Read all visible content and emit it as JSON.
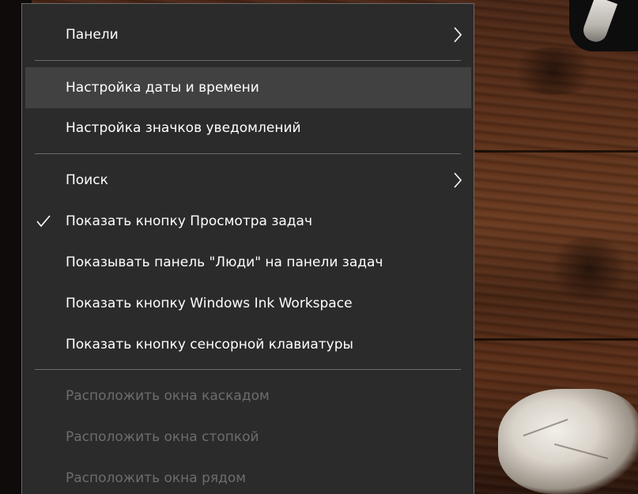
{
  "menu": {
    "items": [
      {
        "label": "Панели",
        "has_submenu": true,
        "checked": false,
        "disabled": false
      },
      {
        "label": "Настройка даты и времени",
        "has_submenu": false,
        "checked": false,
        "disabled": false,
        "hovered": true
      },
      {
        "label": "Настройка значков уведомлений",
        "has_submenu": false,
        "checked": false,
        "disabled": false
      },
      {
        "label": "Поиск",
        "has_submenu": true,
        "checked": false,
        "disabled": false
      },
      {
        "label": "Показать кнопку Просмотра задач",
        "has_submenu": false,
        "checked": true,
        "disabled": false
      },
      {
        "label": "Показывать панель \"Люди\" на панели задач",
        "has_submenu": false,
        "checked": false,
        "disabled": false
      },
      {
        "label": "Показать кнопку Windows Ink Workspace",
        "has_submenu": false,
        "checked": false,
        "disabled": false
      },
      {
        "label": "Показать кнопку сенсорной клавиатуры",
        "has_submenu": false,
        "checked": false,
        "disabled": false
      },
      {
        "label": "Расположить окна каскадом",
        "has_submenu": false,
        "checked": false,
        "disabled": true
      },
      {
        "label": "Расположить окна стопкой",
        "has_submenu": false,
        "checked": false,
        "disabled": true
      },
      {
        "label": "Расположить окна рядом",
        "has_submenu": false,
        "checked": false,
        "disabled": true
      }
    ],
    "icons": {
      "check": "check-icon",
      "submenu": "chevron-right-icon"
    }
  },
  "colors": {
    "menu_background": "#2b2b2b",
    "menu_hover": "#414141",
    "menu_border": "#6a6a6a",
    "text": "#ffffff",
    "text_disabled": "#6d6d6d"
  }
}
